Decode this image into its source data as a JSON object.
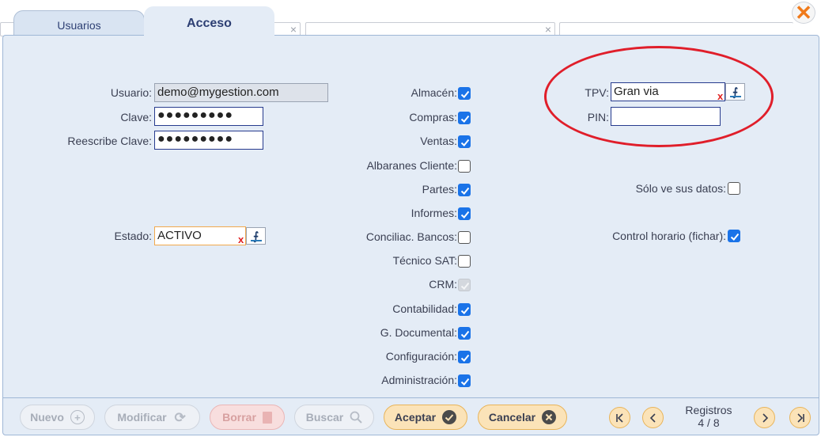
{
  "tabs": {
    "usuarios": "Usuarios",
    "acceso": "Acceso"
  },
  "close_icon": "close-x-icon",
  "user": {
    "usuario_label": "Usuario:",
    "usuario_value": "demo@mygestion.com",
    "clave_label": "Clave:",
    "clave_value": "●●●●●●●●●",
    "reescribe_label": "Reescribe Clave:",
    "reescribe_value": "●●●●●●●●●",
    "estado_label": "Estado:",
    "estado_value": "ACTIVO"
  },
  "permissions": [
    {
      "label": "Almacén:",
      "state": "checked"
    },
    {
      "label": "Compras:",
      "state": "checked"
    },
    {
      "label": "Ventas:",
      "state": "checked"
    },
    {
      "label": "Albaranes Cliente:",
      "state": "unchecked"
    },
    {
      "label": "Partes:",
      "state": "checked"
    },
    {
      "label": "Informes:",
      "state": "checked"
    },
    {
      "label": "Conciliac. Bancos:",
      "state": "unchecked"
    },
    {
      "label": "Técnico SAT:",
      "state": "unchecked"
    },
    {
      "label": "CRM:",
      "state": "disabled-checked"
    },
    {
      "label": "Contabilidad:",
      "state": "checked"
    },
    {
      "label": "G. Documental:",
      "state": "checked"
    },
    {
      "label": "Configuración:",
      "state": "checked"
    },
    {
      "label": "Administración:",
      "state": "checked"
    }
  ],
  "tpv": {
    "tpv_label": "TPV:",
    "tpv_value": "Gran via",
    "pin_label": "PIN:",
    "pin_value": ""
  },
  "options": {
    "solo_label": "Sólo ve sus datos:",
    "solo_state": "unchecked",
    "control_label": "Control horario (fichar):",
    "control_state": "checked"
  },
  "clear_mark": "x",
  "lookup_glyph": "⨍",
  "footer": {
    "nuevo": "Nuevo",
    "modificar": "Modificar",
    "borrar": "Borrar",
    "buscar": "Buscar",
    "aceptar": "Aceptar",
    "cancelar": "Cancelar",
    "registros_label": "Registros",
    "registros_value": "4 / 8"
  },
  "colors": {
    "accent": "#1a73e8",
    "panel": "#e4ecf6",
    "highlight": "#e01e2a",
    "button_accent": "#fbe3b8"
  }
}
